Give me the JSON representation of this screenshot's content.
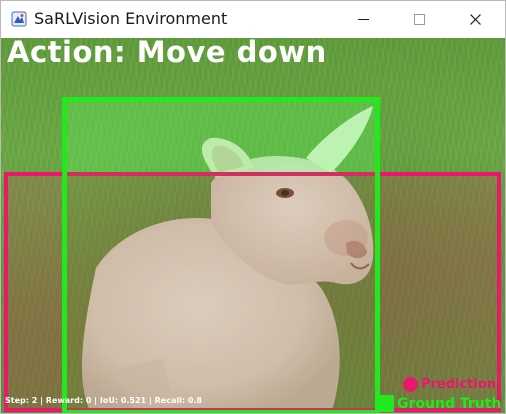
{
  "window": {
    "title": "SaRLVision Environment",
    "controls": [
      "minimize",
      "maximize",
      "close"
    ]
  },
  "overlay": {
    "action_text": "Action: Move down",
    "stats_text": "Step: 2 | Reward: 0 | IoU: 0.521 | Recall: 0.8"
  },
  "legend": {
    "prediction_label": "Prediction",
    "ground_truth_label": "Ground Truth"
  },
  "colors": {
    "prediction": "#e8186a",
    "ground_truth": "#22e81e"
  },
  "scene": {
    "subject": "white lamb on grass"
  }
}
